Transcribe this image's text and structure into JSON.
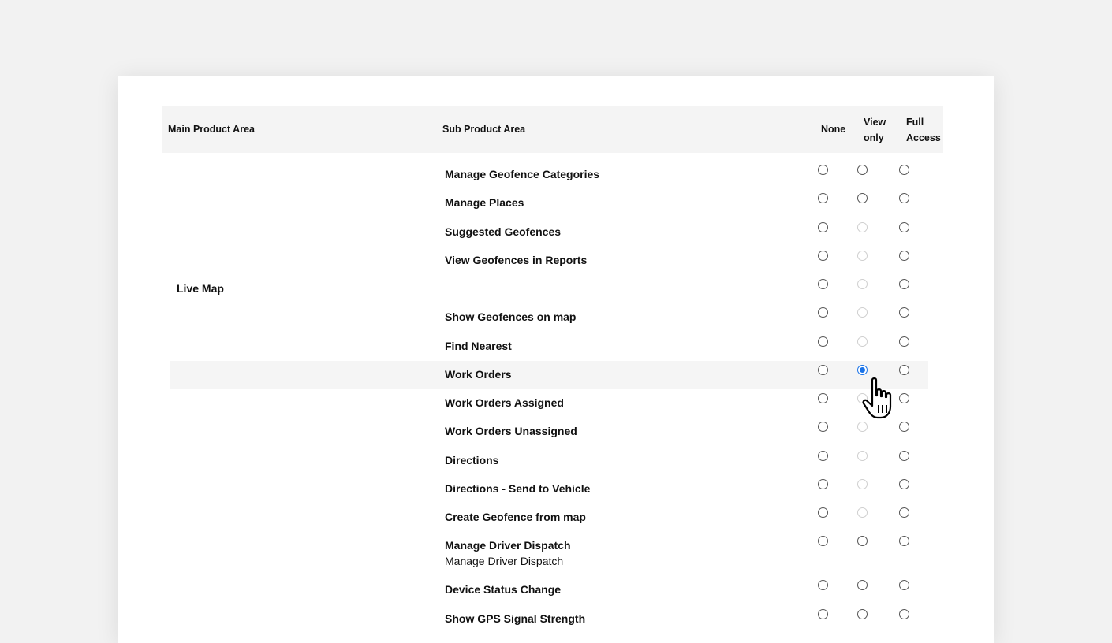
{
  "table": {
    "headers": {
      "main": "Main Product Area",
      "sub": "Sub Product Area",
      "none": "None",
      "view_line1": "View",
      "view_line2": "only",
      "full_line1": "Full",
      "full_line2": "Access"
    },
    "main_area": "Live Map",
    "rows": [
      {
        "label": "Manage Geofence Categories",
        "sublabel": "",
        "view_disabled": false,
        "selected": ""
      },
      {
        "label": "Manage Places",
        "sublabel": "",
        "view_disabled": false,
        "selected": ""
      },
      {
        "label": "Suggested Geofences",
        "sublabel": "",
        "view_disabled": true,
        "selected": ""
      },
      {
        "label": "View Geofences in Reports",
        "sublabel": "",
        "view_disabled": true,
        "selected": ""
      },
      {
        "label": "",
        "sublabel": "",
        "view_disabled": true,
        "selected": ""
      },
      {
        "label": "Show Geofences on map",
        "sublabel": "",
        "view_disabled": true,
        "selected": ""
      },
      {
        "label": "Find Nearest",
        "sublabel": "",
        "view_disabled": true,
        "selected": ""
      },
      {
        "label": "Work Orders",
        "sublabel": "",
        "view_disabled": false,
        "selected": "view",
        "highlighted": true
      },
      {
        "label": "Work Orders Assigned",
        "sublabel": "",
        "view_disabled": true,
        "selected": ""
      },
      {
        "label": "Work Orders Unassigned",
        "sublabel": "",
        "view_disabled": true,
        "selected": ""
      },
      {
        "label": "Directions",
        "sublabel": "",
        "view_disabled": true,
        "selected": ""
      },
      {
        "label": "Directions - Send to Vehicle",
        "sublabel": "",
        "view_disabled": true,
        "selected": ""
      },
      {
        "label": "Create Geofence from map",
        "sublabel": "",
        "view_disabled": true,
        "selected": ""
      },
      {
        "label": "Manage Driver Dispatch",
        "sublabel": "Manage Driver Dispatch",
        "view_disabled": false,
        "selected": ""
      },
      {
        "label": "Device Status Change",
        "sublabel": "",
        "view_disabled": false,
        "selected": ""
      },
      {
        "label": "Show GPS Signal Strength",
        "sublabel": "",
        "view_disabled": false,
        "selected": ""
      }
    ]
  },
  "icons": {
    "cursor": "hand-pointer-icon"
  },
  "colors": {
    "accent": "#1a73e8",
    "header_bg": "#f4f4f4",
    "page_bg": "#f2f2f2"
  }
}
